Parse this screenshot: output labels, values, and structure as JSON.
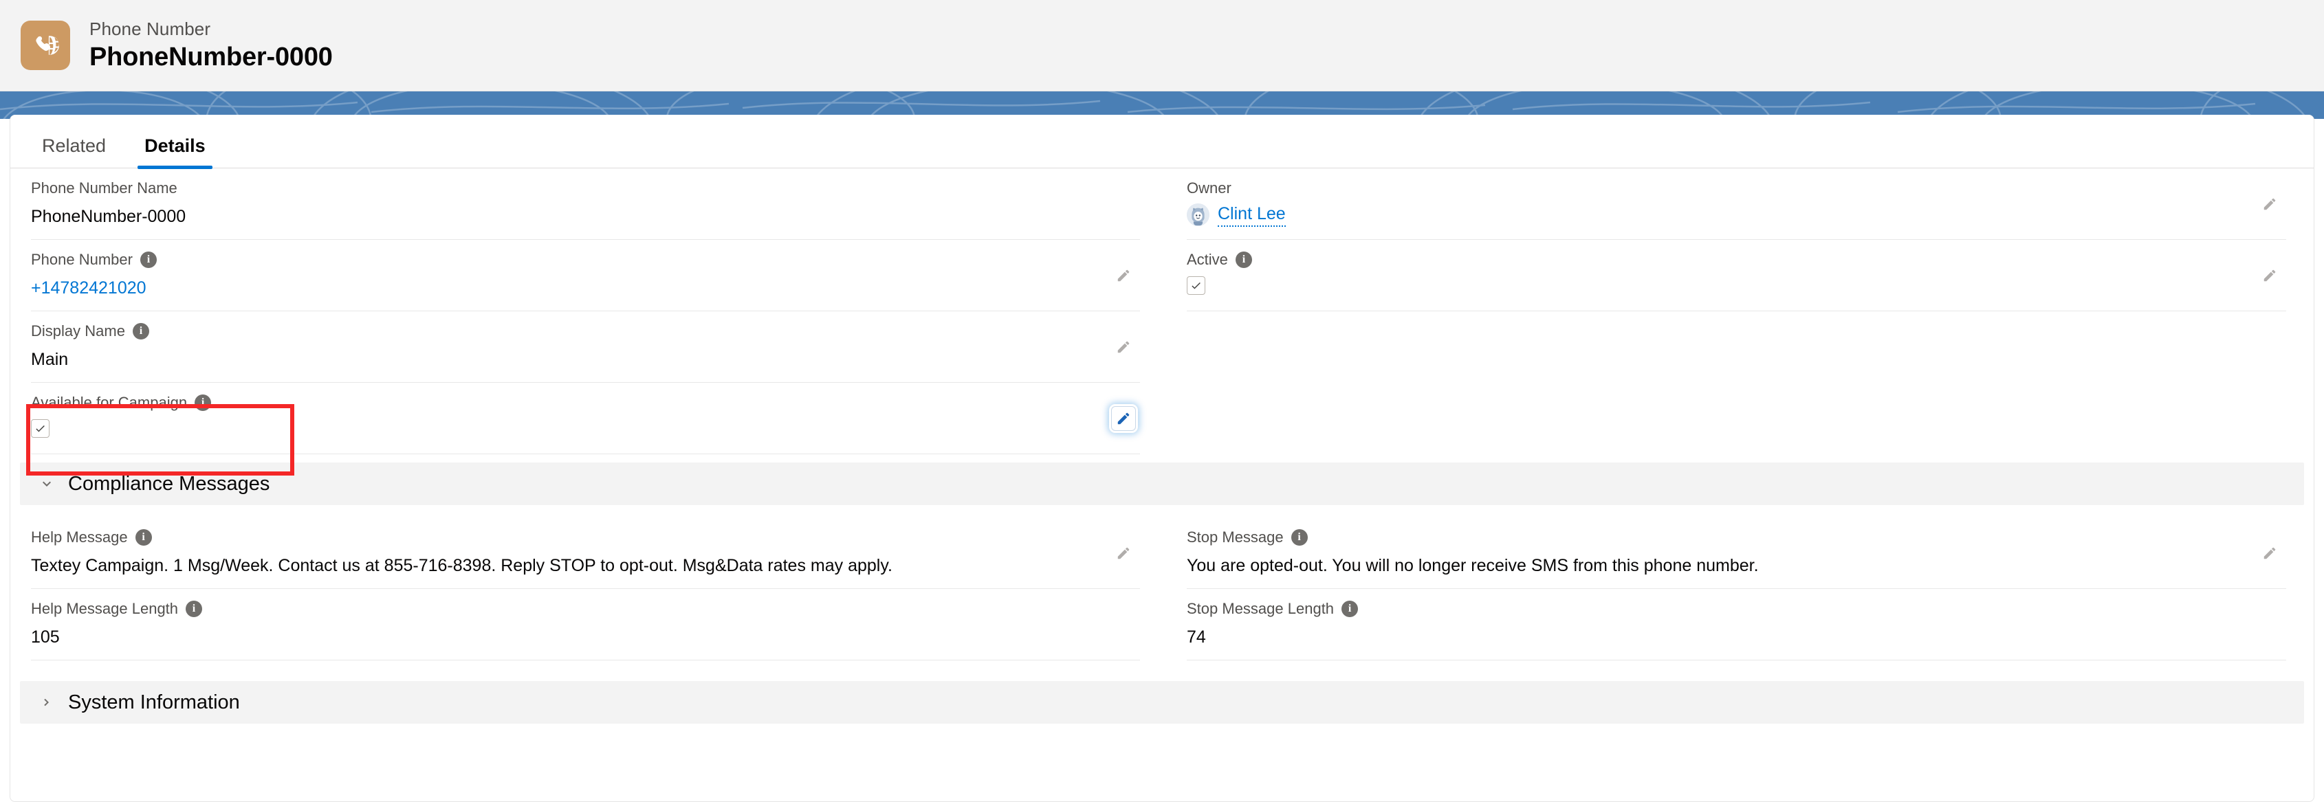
{
  "header": {
    "icon_name": "phone-number-record-icon",
    "icon_color": "#cd9a63",
    "object_label": "Phone Number",
    "record_name": "PhoneNumber-0000"
  },
  "tabs": [
    {
      "label": "Related",
      "active": false
    },
    {
      "label": "Details",
      "active": true
    }
  ],
  "colors": {
    "accent_blue": "#0176d3",
    "banner_blue": "#4a7fb5",
    "highlight_red": "#f42727",
    "section_bg": "#f3f3f3"
  },
  "details": {
    "left_fields": [
      {
        "label": "Phone Number Name",
        "has_info": false,
        "value": "PhoneNumber-0000",
        "type": "text",
        "editable": false
      },
      {
        "label": "Phone Number",
        "has_info": true,
        "value": "+14782421020",
        "type": "link",
        "editable": true
      },
      {
        "label": "Display Name",
        "has_info": true,
        "value": "Main",
        "type": "text",
        "editable": true
      },
      {
        "label": "Available for Campaign",
        "has_info": true,
        "value": "",
        "type": "checkbox",
        "checked": true,
        "editable": true,
        "highlighted": true,
        "pencil_focused": true
      }
    ],
    "right_fields": [
      {
        "label": "Owner",
        "has_info": false,
        "value": "Clint Lee",
        "type": "owner",
        "editable": true
      },
      {
        "label": "Active",
        "has_info": true,
        "value": "",
        "type": "checkbox",
        "checked": true,
        "editable": true
      }
    ]
  },
  "compliance_section": {
    "title": "Compliance Messages",
    "expanded": true,
    "chevron": "chevron-down-icon",
    "left_fields": [
      {
        "label": "Help Message",
        "has_info": true,
        "value": "Textey Campaign. 1 Msg/Week. Contact us at 855-716-8398. Reply STOP to opt-out. Msg&Data rates may apply.",
        "type": "text",
        "editable": true
      },
      {
        "label": "Help Message Length",
        "has_info": true,
        "value": "105",
        "type": "text",
        "editable": false
      }
    ],
    "right_fields": [
      {
        "label": "Stop Message",
        "has_info": true,
        "value": "You are opted-out. You will no longer receive SMS from this phone number.",
        "type": "text",
        "editable": true
      },
      {
        "label": "Stop Message Length",
        "has_info": true,
        "value": "74",
        "type": "text",
        "editable": false
      }
    ]
  },
  "system_section": {
    "title": "System Information",
    "expanded": false,
    "chevron": "chevron-right-icon"
  }
}
